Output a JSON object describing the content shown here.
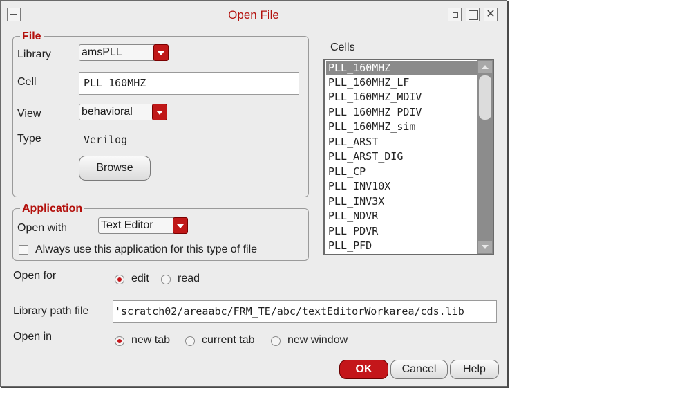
{
  "window": {
    "title": "Open File"
  },
  "file_group": {
    "legend": "File",
    "library_label": "Library",
    "library_value": "amsPLL",
    "cell_label": "Cell",
    "cell_value": "PLL_160MHZ",
    "view_label": "View",
    "view_value": "behavioral",
    "type_label": "Type",
    "type_value": "Verilog",
    "browse_label": "Browse"
  },
  "cells": {
    "label": "Cells",
    "selected": "PLL_160MHZ",
    "items": [
      "PLL_160MHZ",
      "PLL_160MHZ_LF",
      "PLL_160MHZ_MDIV",
      "PLL_160MHZ_PDIV",
      "PLL_160MHZ_sim",
      "PLL_ARST",
      "PLL_ARST_DIG",
      "PLL_CP",
      "PLL_INV10X",
      "PLL_INV3X",
      "PLL_NDVR",
      "PLL_PDVR",
      "PLL_PFD"
    ]
  },
  "application_group": {
    "legend": "Application",
    "open_with_label": "Open with",
    "open_with_value": "Text Editor",
    "always_use_label": "Always use this application for this type of file",
    "always_use_checked": false
  },
  "open_for": {
    "label": "Open for",
    "options": [
      "edit",
      "read"
    ],
    "selected": "edit"
  },
  "library_path": {
    "label": "Library path file",
    "value": "'scratch02/areaabc/FRM_TE/abc/textEditorWorkarea/cds.lib"
  },
  "open_in": {
    "label": "Open in",
    "options": [
      "new tab",
      "current tab",
      "new window"
    ],
    "selected": "new tab"
  },
  "buttons": {
    "ok": "OK",
    "cancel": "Cancel",
    "help": "Help"
  },
  "colors": {
    "accent": "#b3100c",
    "dialog_bg": "#ececec",
    "selected_row": "#8a8a8a"
  },
  "icons": {
    "window_menu": "menu-icon",
    "minimize": "minimize-icon",
    "maximize": "maximize-icon",
    "close": "close-icon"
  }
}
